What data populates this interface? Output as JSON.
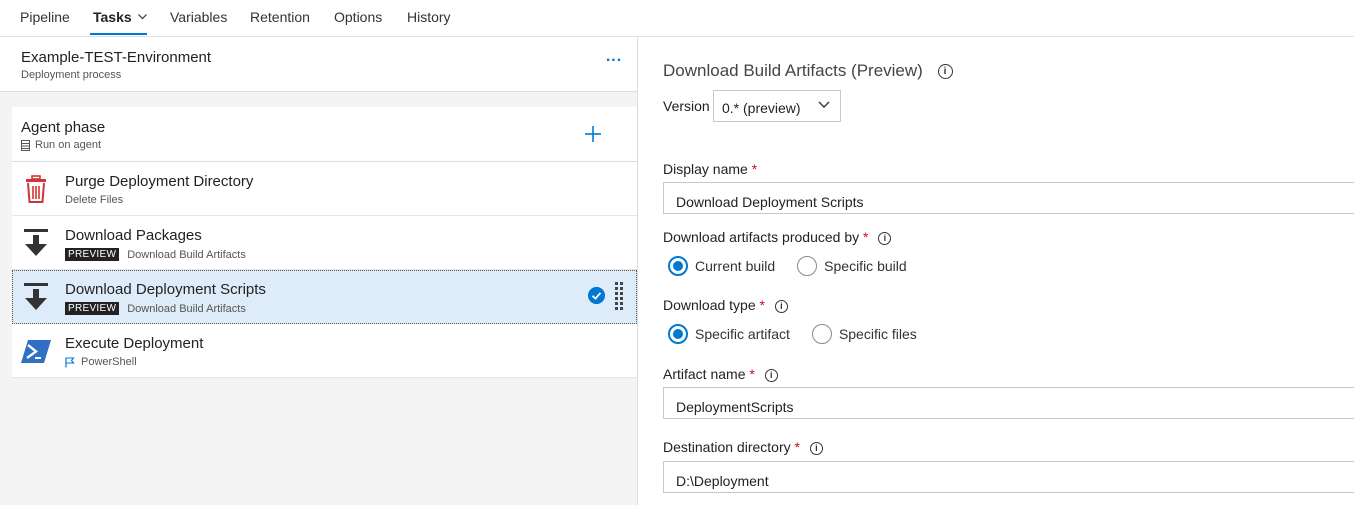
{
  "tabs": [
    {
      "label": "Pipeline"
    },
    {
      "label": "Tasks"
    },
    {
      "label": "Variables"
    },
    {
      "label": "Retention"
    },
    {
      "label": "Options"
    },
    {
      "label": "History"
    }
  ],
  "active_tab": "Tasks",
  "accent_color": "#0078d4",
  "environment": {
    "title": "Example-TEST-Environment",
    "subtitle": "Deployment process",
    "more_label": "..."
  },
  "phase": {
    "title": "Agent phase",
    "subtitle": "Run on agent",
    "add_icon": "plus-icon"
  },
  "tasks": [
    {
      "title": "Purge Deployment Directory",
      "subtitle": "Delete Files",
      "badge": "",
      "icon": "trash-icon",
      "selected": false
    },
    {
      "title": "Download Packages",
      "subtitle": "Download Build Artifacts",
      "badge": "PREVIEW",
      "icon": "download-icon",
      "selected": false
    },
    {
      "title": "Download Deployment Scripts",
      "subtitle": "Download Build Artifacts",
      "badge": "PREVIEW",
      "icon": "download-icon",
      "selected": true
    },
    {
      "title": "Execute Deployment",
      "subtitle": "PowerShell",
      "badge": "",
      "icon": "powershell-icon",
      "selected": false
    }
  ],
  "details": {
    "title": "Download Build Artifacts (Preview)",
    "version_label": "Version",
    "version_value": "0.* (preview)",
    "display_name_label": "Display name",
    "display_name_value": "Download Deployment Scripts",
    "produced_by_label": "Download artifacts produced by",
    "produced_by_options": [
      "Current build",
      "Specific build"
    ],
    "produced_by_selected": "Current build",
    "download_type_label": "Download type",
    "download_type_options": [
      "Specific artifact",
      "Specific files"
    ],
    "download_type_selected": "Specific artifact",
    "artifact_name_label": "Artifact name",
    "artifact_name_value": "DeploymentScripts",
    "destination_label": "Destination directory",
    "destination_value": "D:\\Deployment",
    "required_mark": "*",
    "info_glyph": "i"
  }
}
